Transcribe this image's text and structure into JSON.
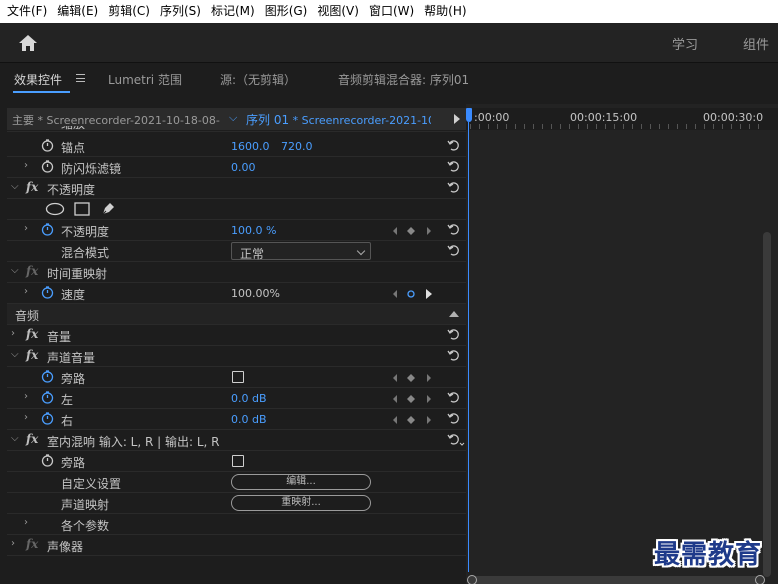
{
  "menu": [
    "文件(F)",
    "编辑(E)",
    "剪辑(C)",
    "序列(S)",
    "标记(M)",
    "图形(G)",
    "视图(V)",
    "窗口(W)",
    "帮助(H)"
  ],
  "workspaces": {
    "learn": "学习",
    "assembly": "组件"
  },
  "tabs": {
    "effect_controls": "效果控件",
    "lumetri": "Lumetri 范围",
    "source": "源:（无剪辑）",
    "audio_mixer": "音频剪辑混合器: 序列01"
  },
  "source_bar": {
    "master": "主要 * Screenrecorder-2021-10-18-08-...",
    "seq_name": "序列 01",
    "seq_clip": " * Screenrecorder-2021-10-..."
  },
  "rows": {
    "partial": "缩放",
    "anchor": {
      "label": "锚点",
      "x": "1600.0",
      "y": "720.0"
    },
    "flicker": {
      "label": "防闪烁滤镜",
      "value": "0.00"
    },
    "opacity_group": "不透明度",
    "opacity": {
      "label": "不透明度",
      "value": "100.0 %"
    },
    "blend": {
      "label": "混合模式",
      "value": "正常"
    },
    "time_remap": "时间重映射",
    "speed": {
      "label": "速度",
      "value": "100.00%"
    },
    "audio_section": "音频",
    "volume": "音量",
    "channel_volume": "声道音量",
    "bypass": "旁路",
    "left": {
      "label": "左",
      "value": "0.0 dB"
    },
    "right": {
      "label": "右",
      "value": "0.0 dB"
    },
    "reverb": "室内混响 输入: L, R | 输出: L, R",
    "bypass2": "旁路",
    "custom_setup": {
      "label": "自定义设置",
      "button": "编辑..."
    },
    "channel_map": {
      "label": "声道映射",
      "button": "重映射..."
    },
    "params": "各个参数",
    "panner": "声像器"
  },
  "timeline": {
    "tc_start": ":00:00",
    "tc_mid": "00:00:15:00",
    "tc_end": "00:00:30:0"
  },
  "watermark": "最需教育",
  "colors": {
    "accent": "#4a9eff",
    "playhead": "#3a8bff",
    "bg": "#1d1d1d"
  }
}
